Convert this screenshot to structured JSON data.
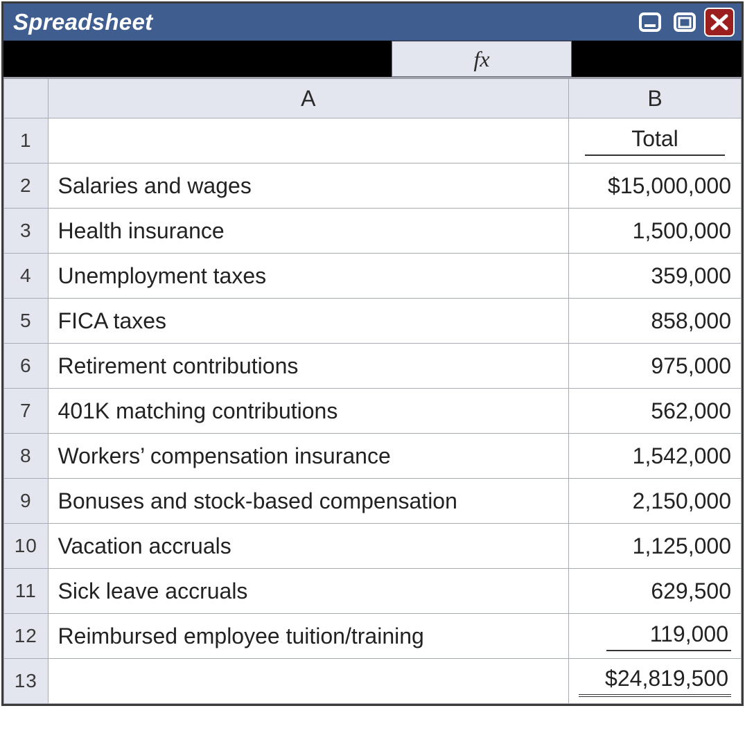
{
  "window": {
    "title": "Spreadsheet"
  },
  "formula": {
    "fx_label": "fx"
  },
  "columns": {
    "A": "A",
    "B": "B"
  },
  "rows": [
    {
      "n": "1",
      "a": "",
      "b": "Total"
    },
    {
      "n": "2",
      "a": "Salaries and wages",
      "b": "$15,000,000"
    },
    {
      "n": "3",
      "a": "Health insurance",
      "b": "1,500,000"
    },
    {
      "n": "4",
      "a": "Unemployment taxes",
      "b": "359,000"
    },
    {
      "n": "5",
      "a": "FICA taxes",
      "b": "858,000"
    },
    {
      "n": "6",
      "a": "Retirement contributions",
      "b": "975,000"
    },
    {
      "n": "7",
      "a": "401K matching contributions",
      "b": "562,000"
    },
    {
      "n": "8",
      "a": "Workers’ compensation insurance",
      "b": "1,542,000"
    },
    {
      "n": "9",
      "a": "Bonuses and stock-based compensation",
      "b": "2,150,000"
    },
    {
      "n": "10",
      "a": "Vacation accruals",
      "b": "1,125,000"
    },
    {
      "n": "11",
      "a": "Sick leave accruals",
      "b": "629,500"
    },
    {
      "n": "12",
      "a": "Reimbursed employee tuition/training",
      "b": "119,000"
    },
    {
      "n": "13",
      "a": "",
      "b": "$24,819,500"
    }
  ],
  "chart_data": {
    "type": "table",
    "title": "Spreadsheet",
    "columns": [
      "A",
      "B"
    ],
    "header_row": {
      "A": "",
      "B": "Total"
    },
    "data": [
      {
        "item": "Salaries and wages",
        "total": 15000000
      },
      {
        "item": "Health insurance",
        "total": 1500000
      },
      {
        "item": "Unemployment taxes",
        "total": 359000
      },
      {
        "item": "FICA taxes",
        "total": 858000
      },
      {
        "item": "Retirement contributions",
        "total": 975000
      },
      {
        "item": "401K matching contributions",
        "total": 562000
      },
      {
        "item": "Workers’ compensation insurance",
        "total": 1542000
      },
      {
        "item": "Bonuses and stock-based compensation",
        "total": 2150000
      },
      {
        "item": "Vacation accruals",
        "total": 1125000
      },
      {
        "item": "Sick leave accruals",
        "total": 629500
      },
      {
        "item": "Reimbursed employee tuition/training",
        "total": 119000
      }
    ],
    "grand_total": 24819500
  }
}
